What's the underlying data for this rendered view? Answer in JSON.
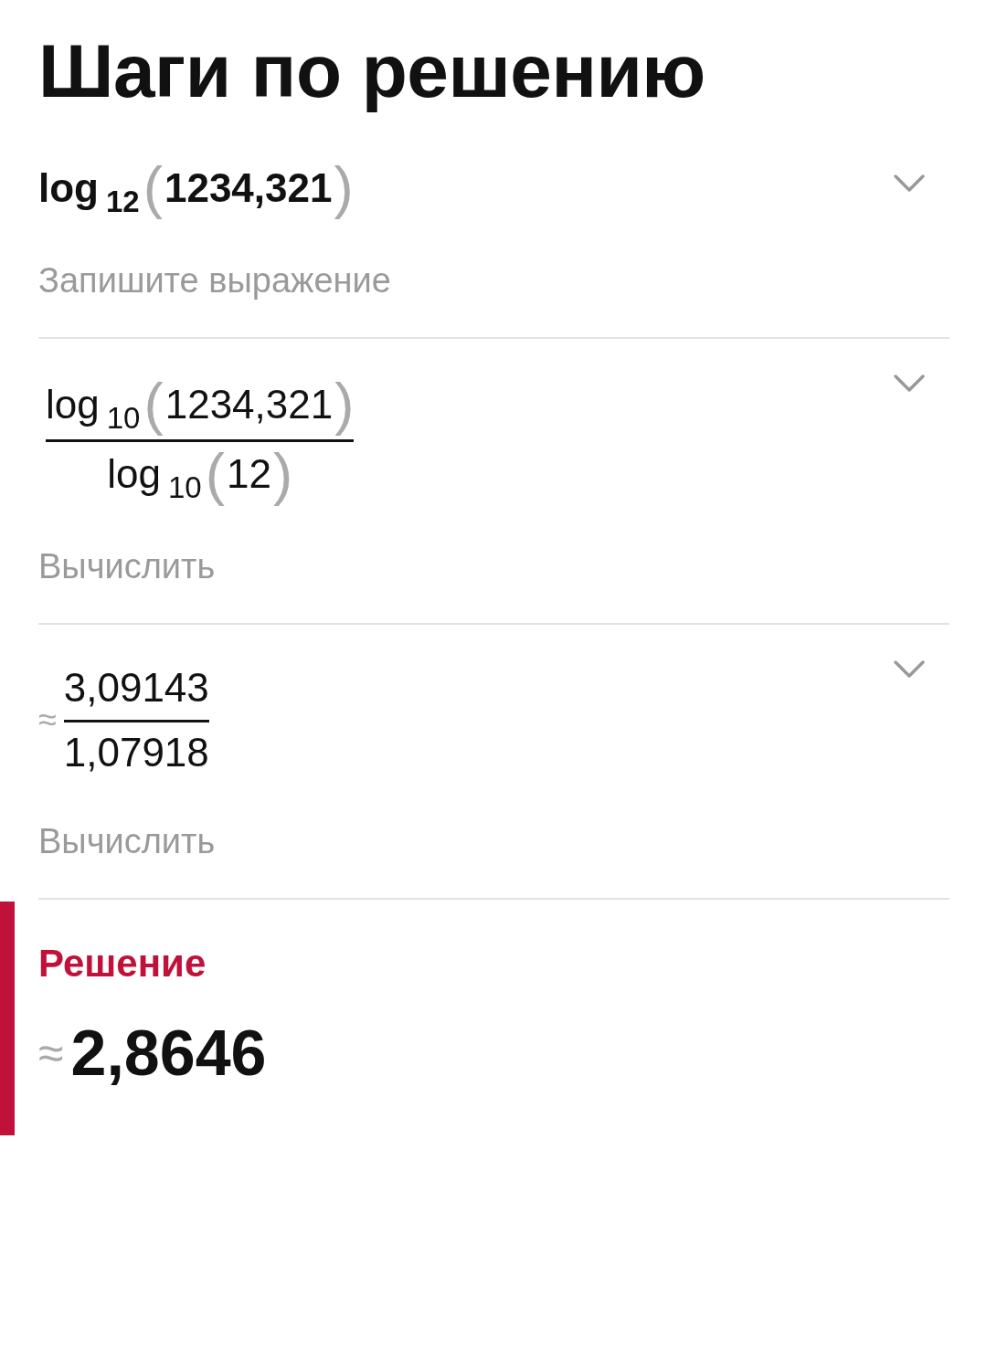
{
  "title": "Шаги по решению",
  "steps": [
    {
      "kind": "log",
      "expression": {
        "fn": "log",
        "base": "12",
        "lparen": "(",
        "arg": "1234,321",
        "rparen": ")"
      },
      "caption": "Запишите выражение",
      "expanded": false
    },
    {
      "kind": "fraction",
      "numerator": {
        "fn": "log",
        "base": "10",
        "lparen": "(",
        "arg": "1234,321",
        "rparen": ")"
      },
      "denominator": {
        "fn": "log",
        "base": "10",
        "lparen": "(",
        "arg": "12",
        "rparen": ")"
      },
      "caption": "Вычислить",
      "expanded": false
    },
    {
      "kind": "approx-fraction",
      "prefix": "≈",
      "numerator": "3,09143",
      "denominator": "1,07918",
      "caption": "Вычислить",
      "expanded": false
    }
  ],
  "solution": {
    "label": "Решение",
    "prefix": "≈",
    "value": "2,8646"
  }
}
